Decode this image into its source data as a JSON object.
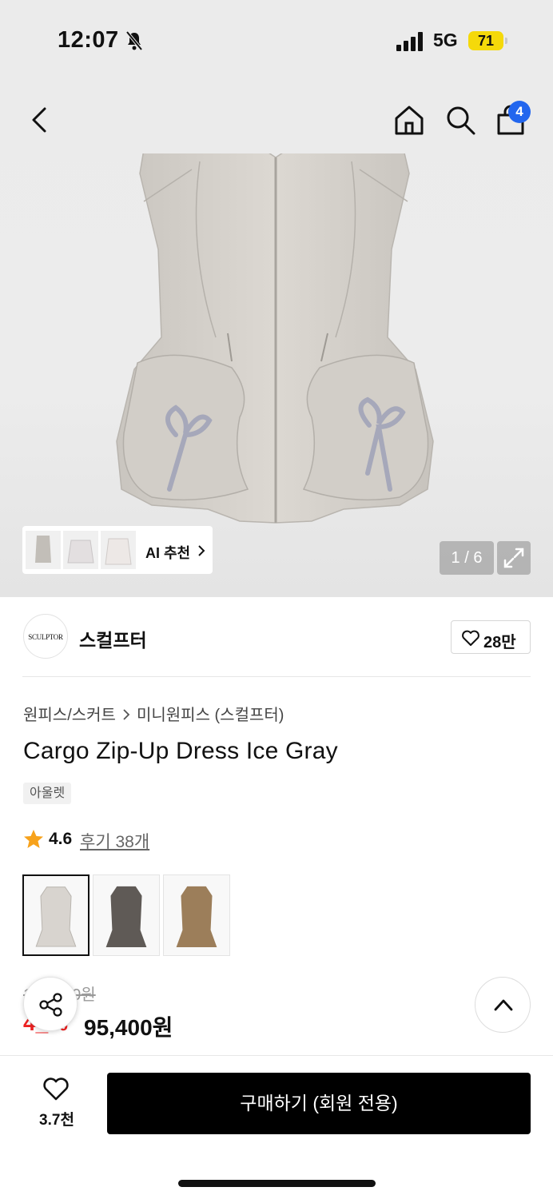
{
  "status_bar": {
    "time": "12:07",
    "network": "5G",
    "battery": "71"
  },
  "header": {
    "cart_count": "4",
    "icons": [
      "back-icon",
      "home-icon",
      "search-icon",
      "cart-icon"
    ]
  },
  "gallery": {
    "ai_label": "AI 추천",
    "pager": "1 / 6"
  },
  "brand": {
    "logo_text": "SCULPTOR",
    "name": "스컬프터",
    "likes": "28만"
  },
  "product": {
    "category": "원피스/스커트",
    "subcategory": "미니원피스 (스컬프터)",
    "title": "Cargo Zip-Up Dress Ice Gray",
    "tag": "아울렛",
    "rating": "4.6",
    "reviews": "후기 38개",
    "original_price": "1__,_00원",
    "discount": "4_%",
    "price": "95,400원",
    "colors": [
      "#d8d4cf",
      "#5f5a56",
      "#9c7e5a"
    ]
  },
  "bottom_bar": {
    "wish_count": "3.7천",
    "buy_label": "구매하기 (회원 전용)"
  }
}
